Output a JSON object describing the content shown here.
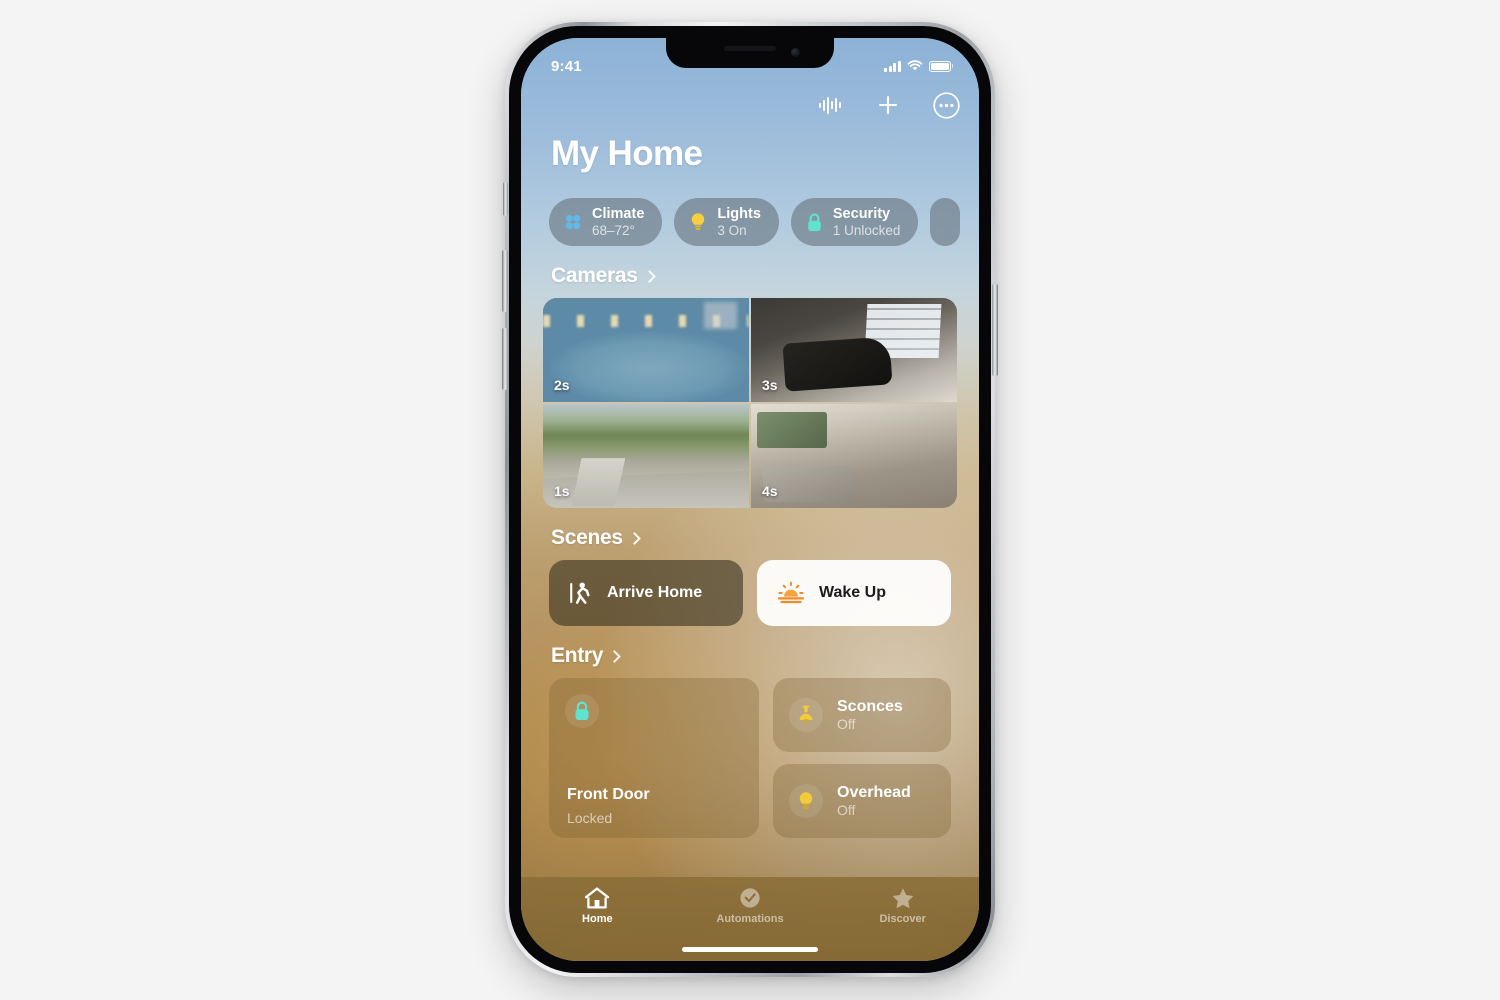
{
  "status_bar": {
    "time": "9:41",
    "cellular_icon": "signal-bars-icon",
    "wifi_icon": "wifi-icon",
    "battery_icon": "battery-full-icon"
  },
  "nav": {
    "intercom_icon": "waveform-intercom-icon",
    "add_icon": "plus-icon",
    "more_icon": "more-ellipsis-circle-icon"
  },
  "header": {
    "title": "My Home"
  },
  "status_pills": [
    {
      "name": "Climate",
      "value": "68–72°",
      "icon": "fan-icon",
      "color": "#63b8ea"
    },
    {
      "name": "Lights",
      "value": "3 On",
      "icon": "bulb-icon",
      "color": "#f5cf3f"
    },
    {
      "name": "Security",
      "value": "1 Unlocked",
      "icon": "lock-icon",
      "color": "#5fe3cf"
    }
  ],
  "sections": {
    "cameras": {
      "title": "Cameras",
      "chevron_icon": "chevron-right-icon",
      "tiles": [
        {
          "label": "2s",
          "scene": "pool-backyard"
        },
        {
          "label": "3s",
          "scene": "garage"
        },
        {
          "label": "1s",
          "scene": "driveway-street"
        },
        {
          "label": "4s",
          "scene": "living-room"
        }
      ]
    },
    "scenes": {
      "title": "Scenes",
      "chevron_icon": "chevron-right-icon",
      "items": [
        {
          "label": "Arrive Home",
          "icon": "walking-person-icon",
          "style": "dark"
        },
        {
          "label": "Wake Up",
          "icon": "sunrise-icon",
          "style": "light"
        }
      ]
    },
    "entry": {
      "title": "Entry",
      "chevron_icon": "chevron-right-icon",
      "primary": {
        "label": "Front Door",
        "state": "Locked",
        "icon": "lock-icon",
        "color": "#5fe3cf"
      },
      "accessories": [
        {
          "label": "Sconces",
          "state": "Off",
          "icon": "sconce-lamp-icon",
          "color": "#f2cb39"
        },
        {
          "label": "Overhead",
          "state": "Off",
          "icon": "bulb-icon",
          "color": "#f2cb39"
        }
      ]
    }
  },
  "tab_bar": {
    "tabs": [
      {
        "label": "Home",
        "icon": "house-icon",
        "active": true
      },
      {
        "label": "Automations",
        "icon": "clock-check-icon",
        "active": false
      },
      {
        "label": "Discover",
        "icon": "star-icon",
        "active": false
      }
    ]
  }
}
